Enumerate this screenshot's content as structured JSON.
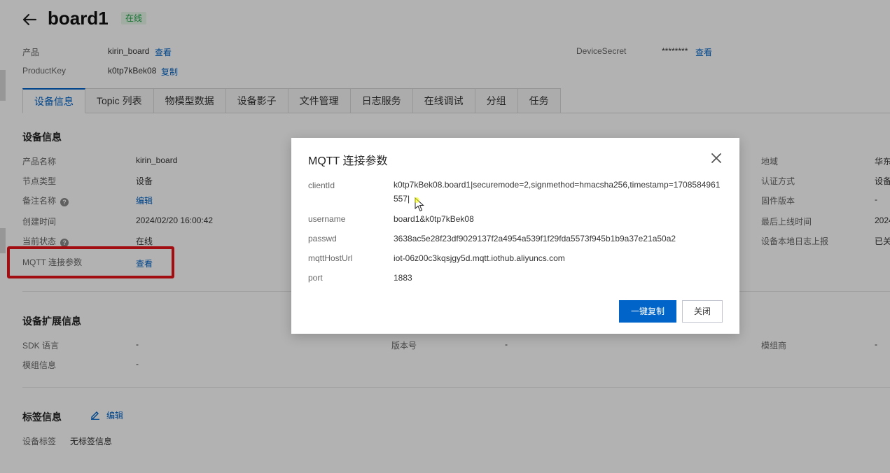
{
  "header": {
    "title": "board1",
    "status": "在线"
  },
  "meta": {
    "product_label": "产品",
    "product_value": "kirin_board",
    "product_link": "查看",
    "productkey_label": "ProductKey",
    "productkey_value": "k0tp7kBek08",
    "productkey_link": "复制",
    "secret_label": "DeviceSecret",
    "secret_value": "********",
    "secret_link": "查看"
  },
  "tabs": [
    {
      "label": "设备信息"
    },
    {
      "label": "Topic 列表"
    },
    {
      "label": "物模型数据"
    },
    {
      "label": "设备影子"
    },
    {
      "label": "文件管理"
    },
    {
      "label": "日志服务"
    },
    {
      "label": "在线调试"
    },
    {
      "label": "分组"
    },
    {
      "label": "任务"
    }
  ],
  "device_info": {
    "title": "设备信息",
    "left": [
      {
        "label": "产品名称",
        "value": "kirin_board"
      },
      {
        "label": "节点类型",
        "value": "设备"
      },
      {
        "label": "备注名称",
        "value": "编辑"
      },
      {
        "label": "创建时间",
        "value": "2024/02/20 16:00:42"
      },
      {
        "label": "当前状态",
        "value": "在线"
      },
      {
        "label": "MQTT 连接参数",
        "value": "查看"
      }
    ],
    "right": [
      {
        "label": "地域",
        "value": "华东"
      },
      {
        "label": "认证方式",
        "value": "设备"
      },
      {
        "label": "固件版本",
        "value": "-"
      },
      {
        "label": "最后上线时间",
        "value": "2024"
      },
      {
        "label": "设备本地日志上报",
        "value": "已关"
      }
    ]
  },
  "ext_info": {
    "title": "设备扩展信息",
    "sdk_label": "SDK 语言",
    "sdk_value": "-",
    "version_label": "版本号",
    "version_value": "-",
    "vendor_label": "模组商",
    "vendor_value": "-",
    "module_label": "模组信息",
    "module_value": "-"
  },
  "tags": {
    "title": "标签信息",
    "edit": "编辑",
    "label": "设备标签",
    "value": "无标签信息"
  },
  "modal": {
    "title": "MQTT 连接参数",
    "rows": [
      {
        "label": "clientId",
        "value": "k0tp7kBek08.board1|securemode=2,signmethod=hmacsha256,timestamp=1708584961557|"
      },
      {
        "label": "username",
        "value": "board1&k0tp7kBek08"
      },
      {
        "label": "passwd",
        "value": "3638ac5e28f23df9029137f2a4954a539f1f29fda5573f945b1b9a37e21a50a2"
      },
      {
        "label": "mqttHostUrl",
        "value": "iot-06z00c3kqsjgy5d.mqtt.iothub.aliyuncs.com"
      },
      {
        "label": "port",
        "value": "1883"
      }
    ],
    "copy_button": "一键复制",
    "close_button": "关闭"
  },
  "colors": {
    "primary": "#0064c8",
    "online": "#23a74a",
    "highlight": "#e8131a"
  }
}
